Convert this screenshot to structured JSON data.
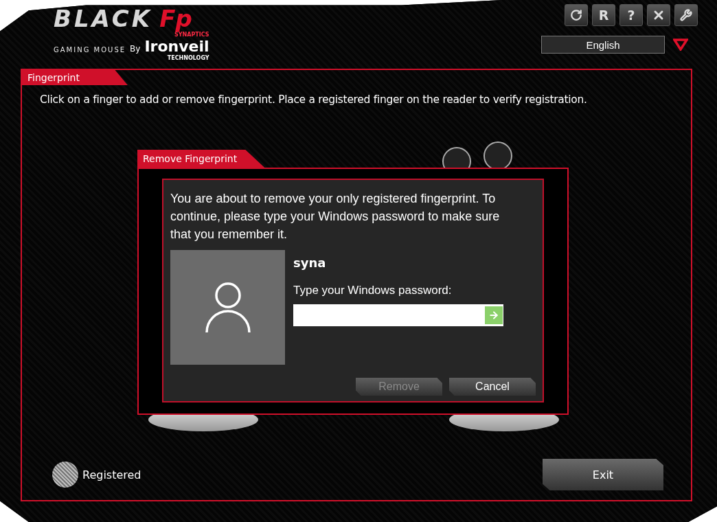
{
  "logo": {
    "brand": "BLACK",
    "badge": "Fp",
    "subtitle": "GAMING MOUSE",
    "by": "By",
    "maker_top": "SYNAPTICS",
    "maker": "Ironveil",
    "maker_bottom": "TECHNOLOGY"
  },
  "toolbar": [
    {
      "kind": "refresh"
    },
    {
      "kind": "text",
      "label": "R"
    },
    {
      "kind": "text",
      "label": "?"
    },
    {
      "kind": "close"
    },
    {
      "kind": "tools"
    }
  ],
  "language": {
    "value": "English"
  },
  "panel": {
    "tab": "Fingerprint",
    "instructions": "Click on a finger to add or remove fingerprint. Place a registered finger on the reader to verify registration.",
    "legend": "Registered",
    "exit": "Exit"
  },
  "dialog": {
    "tab": "Remove Fingerprint",
    "message": "You are about to remove your only registered fingerprint. To continue, please type your Windows password to make sure that you remember it.",
    "user": "syna",
    "prompt": "Type your Windows password:",
    "buttons": [
      {
        "label": "Remove",
        "disabled": true
      },
      {
        "label": "Cancel",
        "disabled": false
      }
    ]
  }
}
